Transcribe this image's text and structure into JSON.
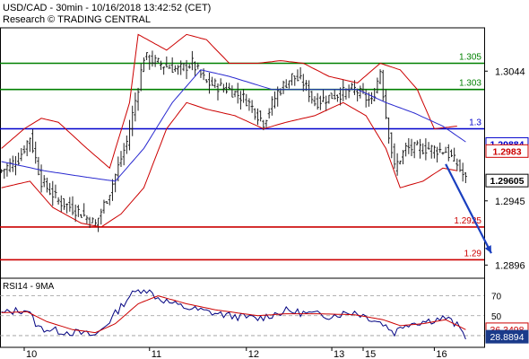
{
  "header": {
    "line1": "USD/CAD - 30min - 10/16/2018 13:42:52 (CET)",
    "line2": "Research © TRADING CENTRAL"
  },
  "colors": {
    "price": "#222222",
    "bollinger": "#cc0000",
    "moving_average": "#2a2ad0",
    "support_resistance_green": "#008000",
    "pivot_blue": "#0000cc",
    "support_red": "#cc0000",
    "arrow": "#1a3fbf",
    "rsi_line": "#000080",
    "rsi_signal": "#cc0000",
    "current_price_box": "#000000",
    "rsi_box": "#1a3a8a"
  },
  "chart_data": [
    {
      "type": "line",
      "panel": "price",
      "title": "USD/CAD - 30min - 10/16/2018 13:42:52 (CET)",
      "x_tick_labels": [
        "10",
        "11",
        "12",
        "13",
        "15",
        "16"
      ],
      "y_tick_labels": [
        "1.3044",
        "1.2945",
        "1.2896"
      ],
      "ylim": [
        1.2888,
        1.3075
      ],
      "x_count": 170,
      "levels": [
        {
          "value": 1.305,
          "label": "1.305",
          "color": "#008000"
        },
        {
          "value": 1.303,
          "label": "1.303",
          "color": "#008000"
        },
        {
          "value": 1.3,
          "label": "1.3",
          "color": "#0000cc"
        },
        {
          "value": 1.2925,
          "label": "1.2925",
          "color": "#cc0000"
        },
        {
          "value": 1.29,
          "label": "1.29",
          "color": "#cc0000"
        }
      ],
      "price_tags": [
        {
          "value": 1.29884,
          "label": "1.29884",
          "style": "blue"
        },
        {
          "value": 1.2983,
          "label": "1.2983",
          "style": "red"
        },
        {
          "value": 1.29605,
          "label": "1.29605",
          "style": "black"
        }
      ],
      "close_anchors": [
        [
          0,
          1.2968
        ],
        [
          6,
          1.2977
        ],
        [
          10,
          1.2994
        ],
        [
          14,
          1.296
        ],
        [
          20,
          1.2945
        ],
        [
          27,
          1.2937
        ],
        [
          33,
          1.2927
        ],
        [
          38,
          1.2952
        ],
        [
          44,
          1.299
        ],
        [
          48,
          1.3032
        ],
        [
          50,
          1.3055
        ],
        [
          55,
          1.305
        ],
        [
          62,
          1.3045
        ],
        [
          67,
          1.305
        ],
        [
          72,
          1.3035
        ],
        [
          80,
          1.303
        ],
        [
          86,
          1.3022
        ],
        [
          92,
          1.3005
        ],
        [
          97,
          1.3028
        ],
        [
          102,
          1.304
        ],
        [
          106,
          1.3035
        ],
        [
          110,
          1.302
        ],
        [
          116,
          1.3025
        ],
        [
          124,
          1.303
        ],
        [
          130,
          1.302
        ],
        [
          133,
          1.3045
        ],
        [
          135,
          1.301
        ],
        [
          138,
          1.297
        ],
        [
          142,
          1.2985
        ],
        [
          150,
          1.2985
        ],
        [
          156,
          1.2983
        ],
        [
          160,
          1.2973
        ],
        [
          163,
          1.2961
        ]
      ],
      "ma_anchors": [
        [
          0,
          1.2975
        ],
        [
          15,
          1.2968
        ],
        [
          30,
          1.2963
        ],
        [
          40,
          1.296
        ],
        [
          50,
          1.2985
        ],
        [
          60,
          1.302
        ],
        [
          70,
          1.3045
        ],
        [
          80,
          1.304
        ],
        [
          95,
          1.303
        ],
        [
          110,
          1.303
        ],
        [
          125,
          1.303
        ],
        [
          135,
          1.302
        ],
        [
          145,
          1.3012
        ],
        [
          155,
          1.3002
        ],
        [
          163,
          1.299
        ]
      ],
      "upper_band_anchors": [
        [
          0,
          1.2985
        ],
        [
          8,
          1.3
        ],
        [
          14,
          1.3008
        ],
        [
          20,
          1.3005
        ],
        [
          30,
          1.2985
        ],
        [
          38,
          1.297
        ],
        [
          45,
          1.302
        ],
        [
          48,
          1.3072
        ],
        [
          58,
          1.306
        ],
        [
          65,
          1.3072
        ],
        [
          72,
          1.3068
        ],
        [
          80,
          1.305
        ],
        [
          90,
          1.305
        ],
        [
          98,
          1.3052
        ],
        [
          106,
          1.305
        ],
        [
          115,
          1.304
        ],
        [
          125,
          1.3035
        ],
        [
          133,
          1.305
        ],
        [
          140,
          1.3045
        ],
        [
          146,
          1.303
        ],
        [
          152,
          1.3
        ],
        [
          160,
          1.3002
        ]
      ],
      "lower_band_anchors": [
        [
          0,
          1.2955
        ],
        [
          10,
          1.296
        ],
        [
          18,
          1.294
        ],
        [
          28,
          1.2928
        ],
        [
          35,
          1.2925
        ],
        [
          42,
          1.2935
        ],
        [
          50,
          1.2955
        ],
        [
          58,
          1.3
        ],
        [
          65,
          1.302
        ],
        [
          72,
          1.3015
        ],
        [
          82,
          1.301
        ],
        [
          92,
          1.3
        ],
        [
          100,
          1.3005
        ],
        [
          110,
          1.301
        ],
        [
          120,
          1.302
        ],
        [
          128,
          1.301
        ],
        [
          135,
          1.2985
        ],
        [
          140,
          1.2955
        ],
        [
          148,
          1.296
        ],
        [
          155,
          1.297
        ],
        [
          160,
          1.2968
        ]
      ],
      "forecast_arrow": {
        "from": [
          156,
          1.2973
        ],
        "to": [
          172,
          1.2905
        ]
      }
    },
    {
      "type": "line",
      "panel": "rsi",
      "title": "RSI14 - 9MA",
      "y_tick_labels": [
        "70",
        "50"
      ],
      "ylim": [
        20,
        85
      ],
      "levels": [
        70,
        50,
        30
      ],
      "value_tags": [
        {
          "value": 36.3498,
          "label": "36.3498",
          "style": "red"
        },
        {
          "value": 28.8894,
          "label": "28.8894",
          "style": "blue"
        }
      ],
      "rsi_anchors": [
        [
          0,
          52
        ],
        [
          5,
          55
        ],
        [
          9,
          56
        ],
        [
          13,
          38
        ],
        [
          19,
          35
        ],
        [
          26,
          33
        ],
        [
          33,
          30
        ],
        [
          38,
          45
        ],
        [
          45,
          70
        ],
        [
          50,
          78
        ],
        [
          55,
          68
        ],
        [
          62,
          60
        ],
        [
          70,
          55
        ],
        [
          80,
          50
        ],
        [
          90,
          47
        ],
        [
          100,
          55
        ],
        [
          108,
          52
        ],
        [
          115,
          50
        ],
        [
          124,
          54
        ],
        [
          130,
          47
        ],
        [
          134,
          42
        ],
        [
          138,
          33
        ],
        [
          142,
          42
        ],
        [
          150,
          45
        ],
        [
          156,
          48
        ],
        [
          160,
          40
        ],
        [
          163,
          29
        ]
      ],
      "signal_anchors": [
        [
          0,
          53
        ],
        [
          9,
          54
        ],
        [
          16,
          44
        ],
        [
          25,
          36
        ],
        [
          33,
          33
        ],
        [
          40,
          42
        ],
        [
          48,
          62
        ],
        [
          55,
          70
        ],
        [
          65,
          62
        ],
        [
          75,
          56
        ],
        [
          90,
          50
        ],
        [
          100,
          52
        ],
        [
          110,
          52
        ],
        [
          124,
          51
        ],
        [
          134,
          46
        ],
        [
          140,
          40
        ],
        [
          148,
          42
        ],
        [
          156,
          46
        ],
        [
          163,
          36
        ]
      ]
    }
  ]
}
